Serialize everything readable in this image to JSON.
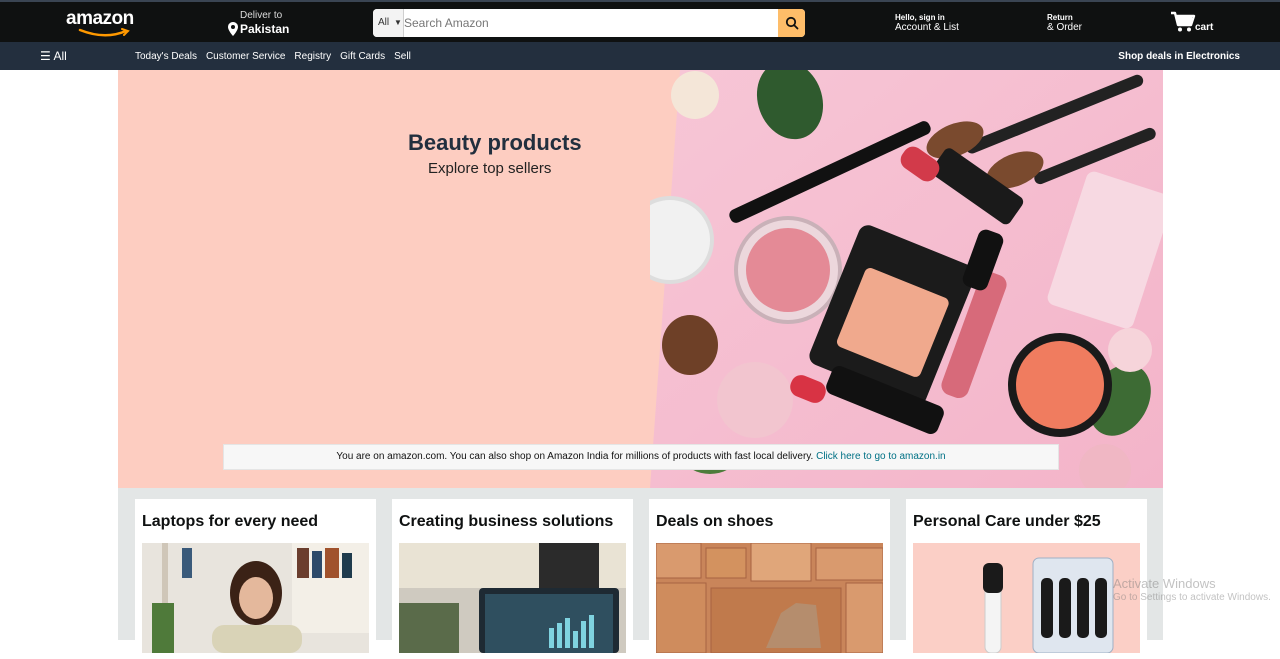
{
  "header": {
    "logo_text": "amazon",
    "deliver_line1": "Deliver to",
    "deliver_line2": "Pakistan",
    "search_category": "All",
    "search_placeholder": "Search Amazon",
    "account_line1": "Hello, sign in",
    "account_line2": "Account & List",
    "returns_line1": "Return",
    "returns_line2": "& Order",
    "cart_label": "cart"
  },
  "subnav": {
    "all_label": "All",
    "links": [
      "Today's Deals",
      "Customer Service",
      "Registry",
      "Gift Cards",
      "Sell"
    ],
    "promo": "Shop deals in Electronics"
  },
  "hero": {
    "title": "Beauty products",
    "subtitle": "Explore top sellers"
  },
  "notice": {
    "text": "You are on amazon.com. You can also shop on Amazon India for millions of products with fast local delivery. ",
    "link": "Click here to go to amazon.in"
  },
  "cards": [
    {
      "title": "Laptops for every need"
    },
    {
      "title": "Creating business solutions"
    },
    {
      "title": "Deals on shoes"
    },
    {
      "title": "Personal Care under $25"
    }
  ],
  "watermark": {
    "line1": "Activate Windows",
    "line2": "Go to Settings to activate Windows."
  },
  "colors": {
    "topbar": "#0f1111",
    "subnav": "#232f3e",
    "search_button": "#febd69",
    "hero_bg": "#fdcdc1",
    "link": "#007185"
  }
}
